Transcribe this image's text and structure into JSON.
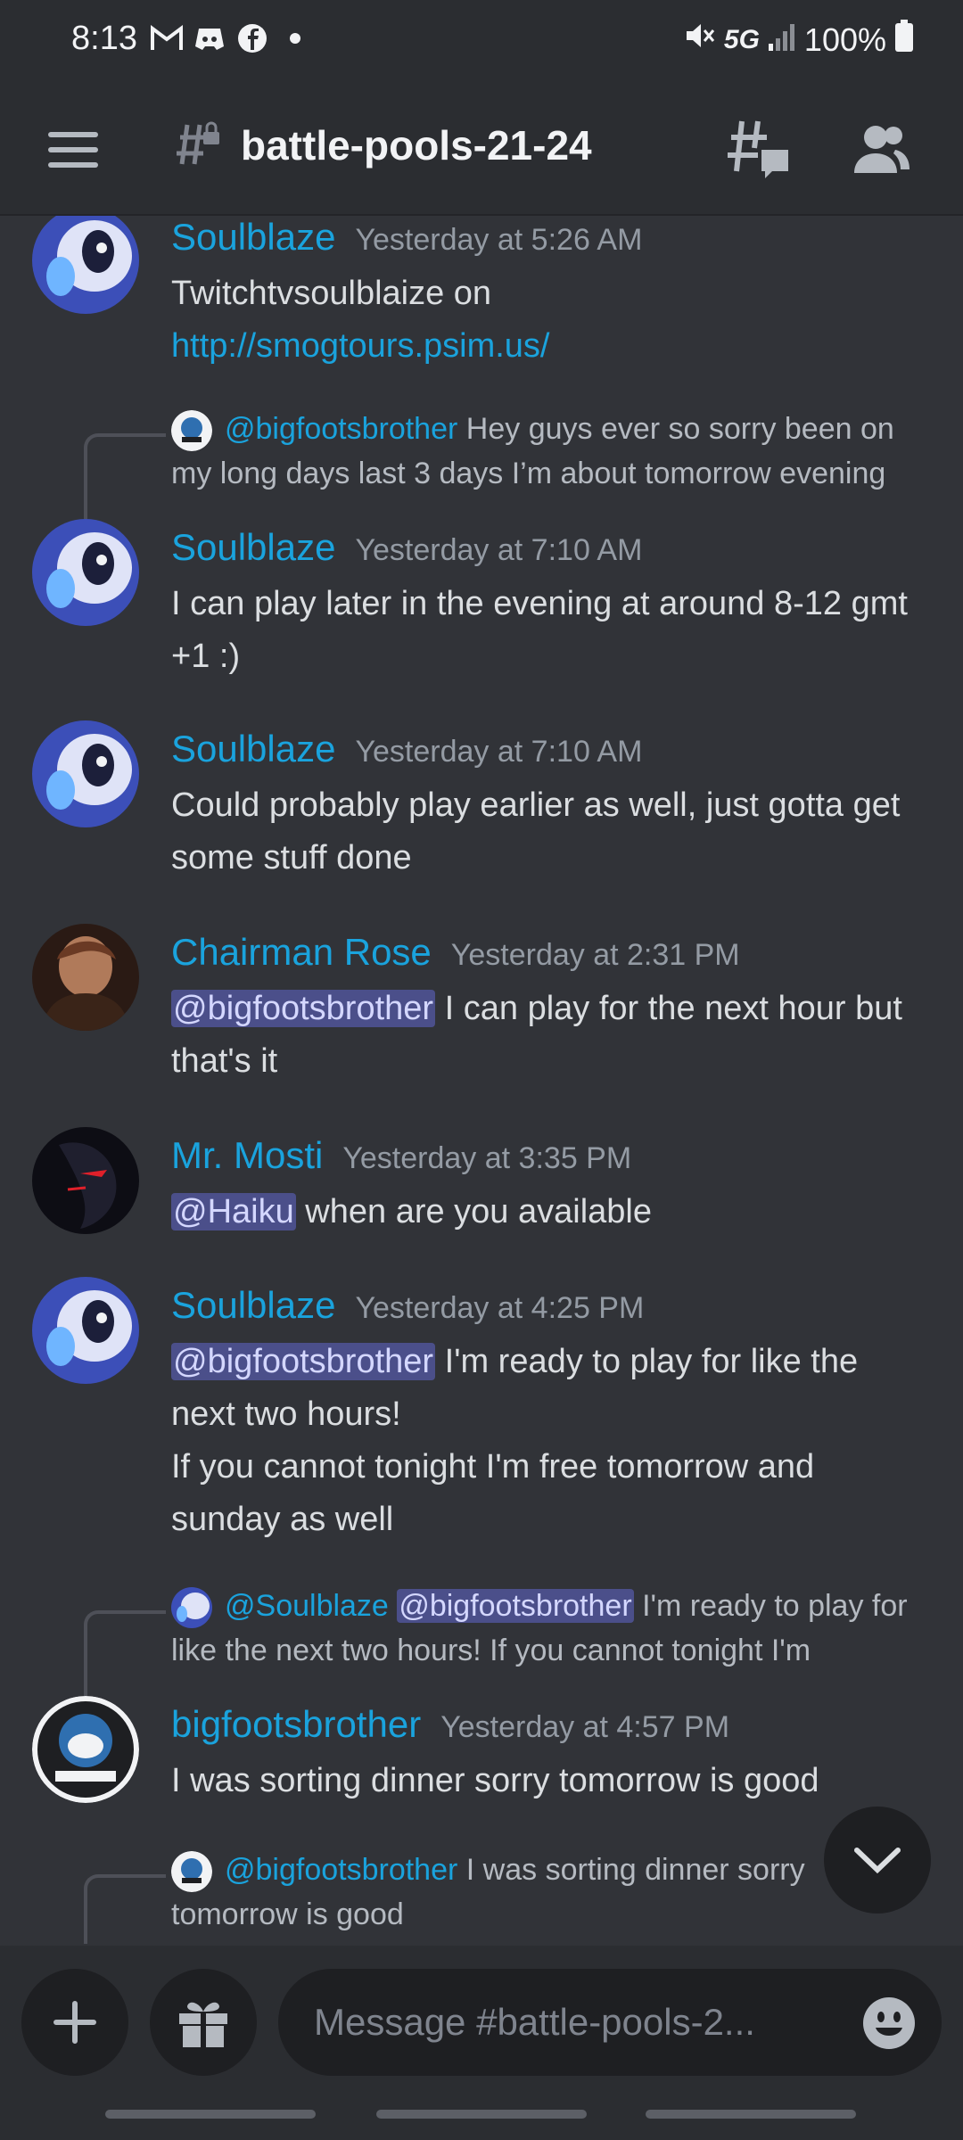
{
  "status_bar": {
    "time": "8:13",
    "network": "5G",
    "battery": "100%"
  },
  "header": {
    "channel_name": "battle-pools-21-24"
  },
  "messages": [
    {
      "author": "Soulblaze",
      "time": "Yesterday at 5:26 AM",
      "text_line1": "Twitchtvsoulblaize on",
      "link": "http://smogtours.psim.us/"
    },
    {
      "reply": {
        "author": "@bigfootsbrother",
        "text": "Hey guys ever so sorry been on my long days last 3 days I’m about tomorrow evening"
      },
      "author": "Soulblaze",
      "time": "Yesterday at 7:10 AM",
      "text": "I can play later in the evening at around 8-12 gmt +1 :)"
    },
    {
      "author": "Soulblaze",
      "time": "Yesterday at 7:10 AM",
      "text": "Could probably play earlier as well, just gotta get some stuff done"
    },
    {
      "author": "Chairman Rose",
      "time": "Yesterday at 2:31 PM",
      "mention": "@bigfootsbrother",
      "text": " I can play for the next hour but that's it"
    },
    {
      "author": "Mr. Mosti",
      "time": "Yesterday at 3:35 PM",
      "mention": "@Haiku",
      "text": " when are you available"
    },
    {
      "author": "Soulblaze",
      "time": "Yesterday at 4:25 PM",
      "mention": "@bigfootsbrother",
      "text": " I'm ready to play for like the next two hours!",
      "text2": "If you cannot tonight I'm free tomorrow and sunday as well"
    },
    {
      "reply": {
        "author": "@Soulblaze",
        "mention": "@bigfootsbrother",
        "text": " I'm ready to play for like the next two hours! If you cannot tonight I'm"
      },
      "author": "bigfootsbrother",
      "time": "Yesterday at 4:57 PM",
      "text": "I was sorting dinner sorry tomorrow is good"
    },
    {
      "reply": {
        "author": "@bigfootsbrother",
        "text": "I was sorting dinner sorry tomorrow is good"
      }
    }
  ],
  "composer": {
    "placeholder": "Message #battle-pools-2..."
  },
  "colors": {
    "background": "#313338",
    "header": "#2b2d31",
    "username": "#1aa3dd",
    "mention_bg": "#4b4f8a"
  }
}
